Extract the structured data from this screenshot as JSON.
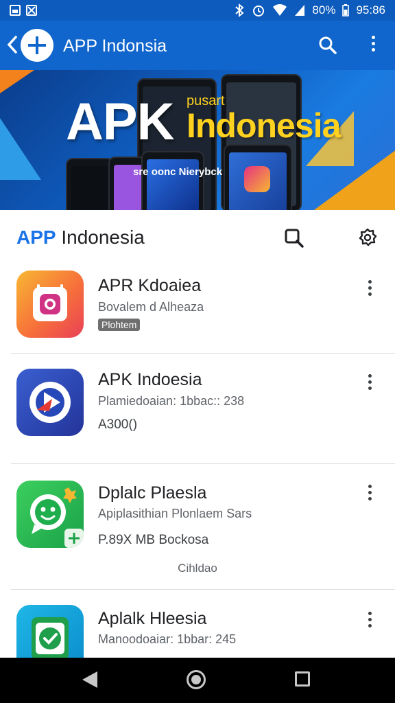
{
  "status_bar": {
    "battery_text": "80%",
    "time": "95:86"
  },
  "app_bar": {
    "title": "APP Indonsia"
  },
  "banner": {
    "big": "APK",
    "small": "pusart",
    "name": "Indonesia",
    "caption": "sre oonc Nierybck"
  },
  "section": {
    "title_accent": "APP",
    "title_rest": " Indonesia"
  },
  "apps": [
    {
      "name": "APR Kdoaiea",
      "sub": "Bovalem d Alheaza",
      "badge": "Plohtem"
    },
    {
      "name": "APK Indoesia",
      "sub": "Plamiedoaian: 1bbac:: 238",
      "third": "A300()"
    },
    {
      "name": "Dplalc Plaesla",
      "sub": "Apiplasithian Plonlaem Sars",
      "third": "P.89X MB Bockosa",
      "extra": "Cihldao"
    },
    {
      "name": "Aplalk Hleesia",
      "sub": "Manoodoaiar: 1bbar: 245"
    }
  ],
  "colors": {
    "status_bar": "#0d5bbd",
    "app_bar": "#1066cc",
    "accent": "#1a73e8",
    "banner_yellow": "#ffd21f"
  },
  "icons": [
    "image-icon",
    "x-square-icon",
    "bluetooth-icon",
    "alarm-icon",
    "wifi-icon",
    "signal-icon",
    "back-chevron-icon",
    "search-icon",
    "more-vert-icon",
    "gear-icon",
    "nav-back-icon",
    "nav-home-icon",
    "nav-recents-icon"
  ]
}
